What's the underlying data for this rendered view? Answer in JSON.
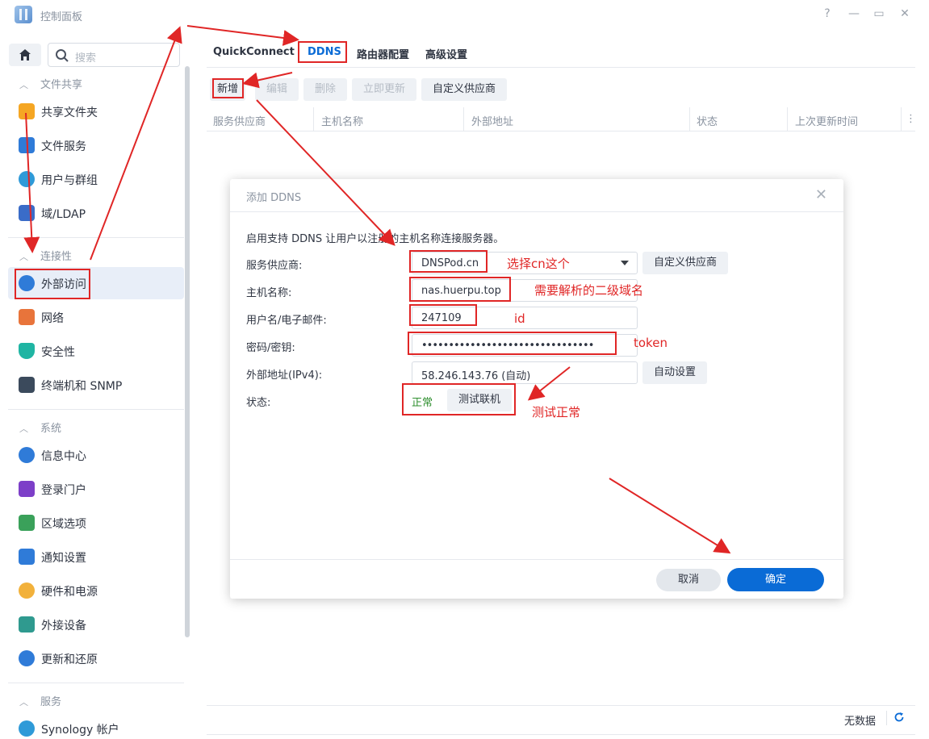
{
  "window": {
    "title": "控制面板",
    "controls": {
      "help": "?",
      "minimize": "—",
      "maximize": "▭",
      "close": "✕"
    }
  },
  "sidebar": {
    "search_placeholder": "搜索",
    "sections": [
      {
        "title": "文件共享",
        "items": [
          {
            "label": "共享文件夹",
            "icon": "shared-folder-icon",
            "color": "#f5a623"
          },
          {
            "label": "文件服务",
            "icon": "file-services-icon",
            "color": "#2f7bd8"
          },
          {
            "label": "用户与群组",
            "icon": "users-groups-icon",
            "color": "#2f9ad8"
          },
          {
            "label": "域/LDAP",
            "icon": "ldap-icon",
            "color": "#3a6cc8"
          }
        ]
      },
      {
        "title": "连接性",
        "items": [
          {
            "label": "外部访问",
            "icon": "external-access-icon",
            "color": "#2f7bd8",
            "active": true
          },
          {
            "label": "网络",
            "icon": "network-icon",
            "color": "#e8743b"
          },
          {
            "label": "安全性",
            "icon": "security-icon",
            "color": "#1fb5a3"
          },
          {
            "label": "终端机和 SNMP",
            "icon": "terminal-icon",
            "color": "#3b4a5c"
          }
        ]
      },
      {
        "title": "系统",
        "items": [
          {
            "label": "信息中心",
            "icon": "info-center-icon",
            "color": "#2f7bd8"
          },
          {
            "label": "登录门户",
            "icon": "login-portal-icon",
            "color": "#7d3fc8"
          },
          {
            "label": "区域选项",
            "icon": "regional-options-icon",
            "color": "#3aa15a"
          },
          {
            "label": "通知设置",
            "icon": "notification-icon",
            "color": "#2f7bd8"
          },
          {
            "label": "硬件和电源",
            "icon": "hardware-power-icon",
            "color": "#f2b13b"
          },
          {
            "label": "外接设备",
            "icon": "external-devices-icon",
            "color": "#2f9a8f"
          },
          {
            "label": "更新和还原",
            "icon": "update-restore-icon",
            "color": "#2f7bd8"
          }
        ]
      },
      {
        "title": "服务",
        "items": [
          {
            "label": "Synology 帐户",
            "icon": "synology-account-icon",
            "color": "#2f9ad8"
          }
        ]
      }
    ]
  },
  "main": {
    "tabs": [
      "QuickConnect",
      "DDNS",
      "路由器配置",
      "高级设置"
    ],
    "active_tab": "DDNS",
    "toolbar": {
      "add": "新增",
      "edit": "编辑",
      "delete": "删除",
      "update_now": "立即更新",
      "custom_provider": "自定义供应商"
    },
    "columns": [
      "服务供应商",
      "主机名称",
      "外部地址",
      "状态",
      "上次更新时间"
    ],
    "menu_glyph": "⋮",
    "footer": {
      "no_data": "无数据"
    }
  },
  "dialog": {
    "title": "添加 DDNS",
    "description": "启用支持 DDNS 让用户以注册的主机名称连接服务器。",
    "fields": {
      "provider_label": "服务供应商:",
      "provider_value": "DNSPod.cn",
      "hostname_label": "主机名称:",
      "hostname_value": "nas.huerpu.top",
      "username_label": "用户名/电子邮件:",
      "username_value": "247109",
      "password_label": "密码/密钥:",
      "password_value": "••••••••••••••••••••••••••••••••",
      "address_label": "外部地址(IPv4):",
      "address_value": "58.246.143.76 (自动)",
      "status_label": "状态:",
      "status_value": "正常"
    },
    "buttons": {
      "custom_provider": "自定义供应商",
      "auto_setup": "自动设置",
      "test_connection": "测试联机",
      "cancel": "取消",
      "ok": "确定"
    }
  },
  "annotations": {
    "provider_note": "选择cn这个",
    "hostname_note": "需要解析的二级域名",
    "id_note": "id",
    "token_note": "token",
    "test_note": "测试正常",
    "color": "#e02626"
  }
}
